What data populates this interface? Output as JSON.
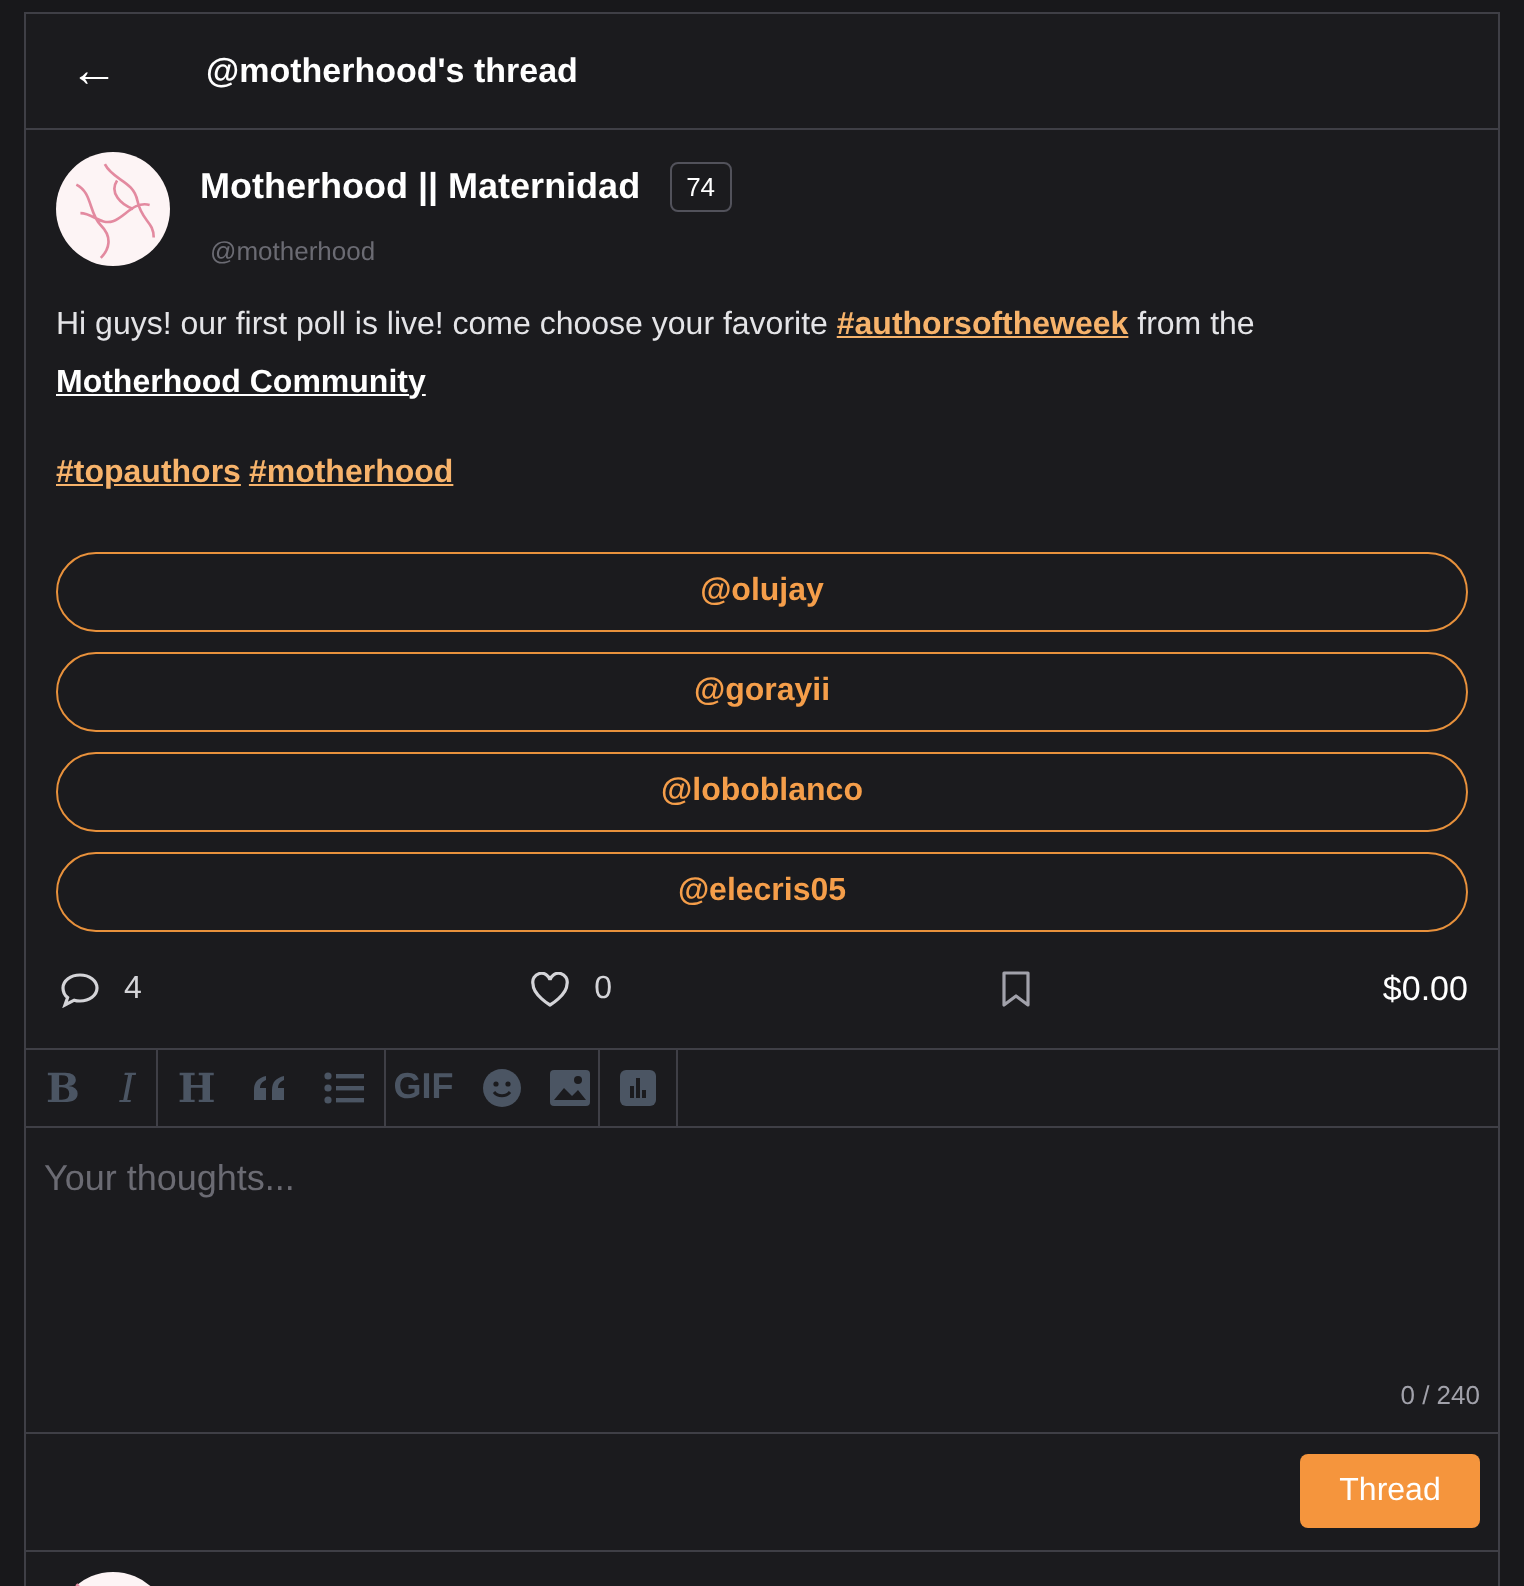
{
  "header": {
    "back": "←",
    "title": "@motherhood's thread"
  },
  "post": {
    "author": "Motherhood || Maternidad",
    "badge": "74",
    "handle": "@motherhood",
    "body": [
      {
        "kind": "text",
        "text": "Hi guys! our first poll is live! come choose your favorite "
      },
      {
        "kind": "hashtag",
        "text": "#authorsoftheweek"
      },
      {
        "kind": "text",
        "text": " from the "
      },
      {
        "kind": "community",
        "text": "Motherhood Community"
      }
    ],
    "tags": [
      "#topauthors",
      "#motherhood"
    ],
    "poll_options": [
      "@olujay",
      "@gorayii",
      "@loboblanco",
      "@elecris05"
    ],
    "comments": "4",
    "likes": "0",
    "tips": "$0.00"
  },
  "editor": {
    "toolbar_labels": [
      "B",
      "I",
      "H",
      "GIF"
    ],
    "placeholder": "Your thoughts...",
    "counter": "0 / 240",
    "submit": "Thread"
  }
}
